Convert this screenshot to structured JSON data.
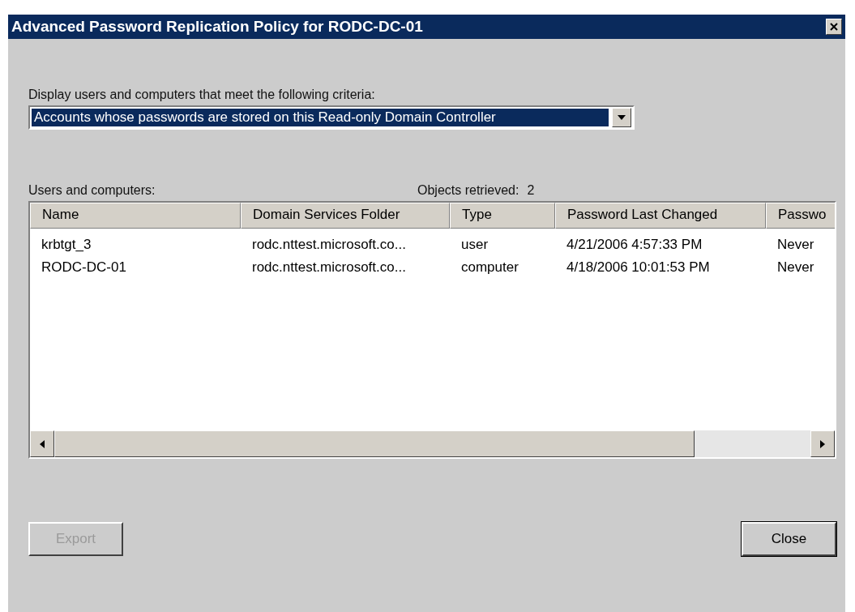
{
  "window": {
    "title": "Advanced Password Replication Policy for RODC-DC-01"
  },
  "criteria": {
    "label": "Display users and computers that meet the following criteria:",
    "value": "Accounts whose passwords are stored on this Read-only Domain Controller",
    "selected": true
  },
  "list": {
    "label": "Users and computers:",
    "count_label": "Objects retrieved:",
    "count": "2",
    "columns": [
      "Name",
      "Domain Services Folder",
      "Type",
      "Password Last Changed",
      "Passwo"
    ],
    "rows": [
      {
        "cells": [
          "krbtgt_3",
          "rodc.nttest.microsoft.co...",
          "user",
          "4/21/2006 4:57:33 PM",
          "Never"
        ]
      },
      {
        "cells": [
          "RODC-DC-01",
          "rodc.nttest.microsoft.co...",
          "computer",
          "4/18/2006 10:01:53 PM",
          "Never"
        ]
      }
    ]
  },
  "buttons": [
    {
      "label": "Export",
      "disabled": true
    },
    {
      "label": "Close",
      "disabled": false
    }
  ]
}
